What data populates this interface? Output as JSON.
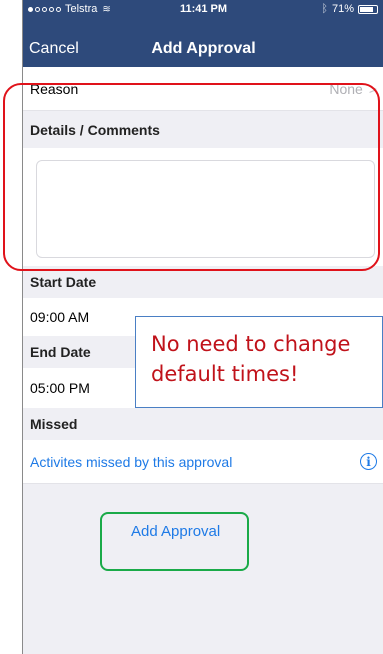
{
  "status_bar": {
    "carrier": "Telstra",
    "time": "11:41 PM",
    "battery": "71%"
  },
  "nav": {
    "cancel_label": "Cancel",
    "title": "Add Approval"
  },
  "form": {
    "reason_label": "Reason",
    "reason_value": "None",
    "details_header": "Details / Comments",
    "details_value": "",
    "start_date_header": "Start Date",
    "start_time": "09:00 AM",
    "end_date_header": "End Date",
    "end_time": "05:00 PM",
    "missed_header": "Missed",
    "missed_link": "Activites missed by this approval",
    "info_glyph": "i",
    "add_button_label": "Add Approval"
  },
  "annotation": {
    "callout_line1": "No need to change",
    "callout_line2": "default times!"
  },
  "colors": {
    "nav_bar": "#2e4a7b",
    "link": "#1e7ae6",
    "annotation_red": "#e0121a",
    "annotation_green": "#1aaa48",
    "callout_border": "#4a7fc4"
  }
}
